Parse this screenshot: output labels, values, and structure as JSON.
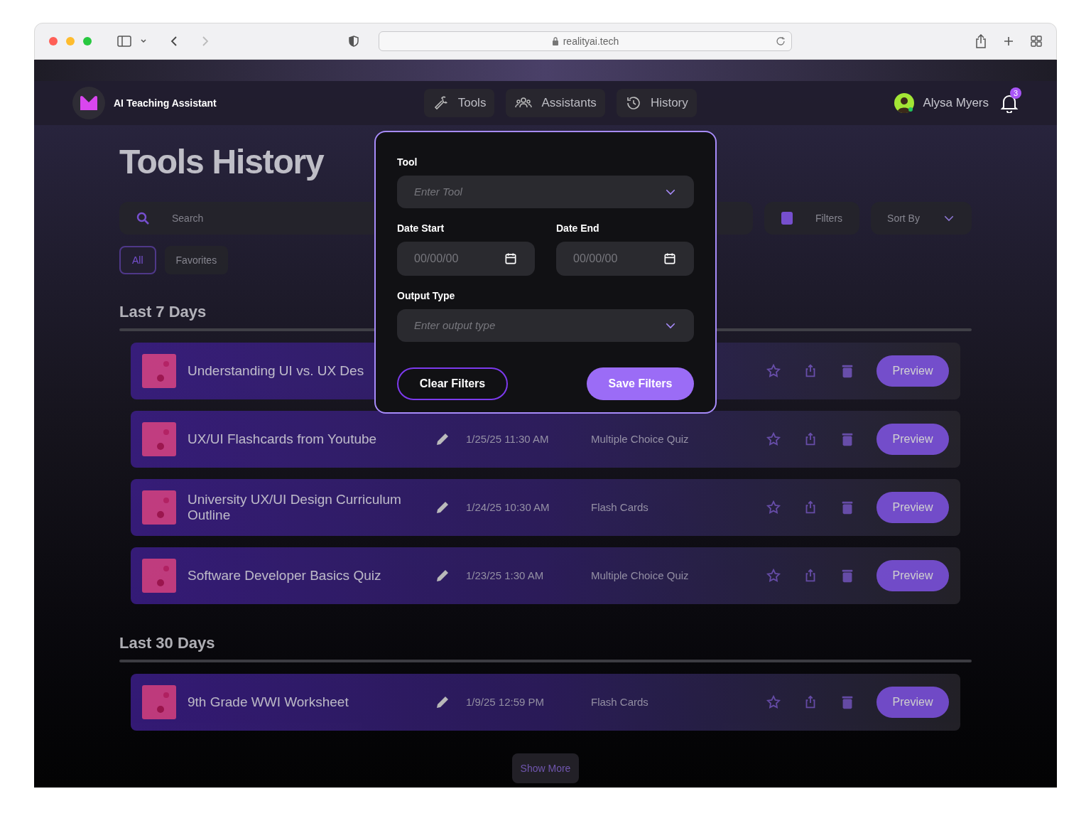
{
  "browser": {
    "url": "realityai.tech"
  },
  "header": {
    "app_name": "AI Teaching Assistant",
    "nav": [
      {
        "label": "Tools"
      },
      {
        "label": "Assistants"
      },
      {
        "label": "History"
      }
    ],
    "user_name": "Alysa Myers",
    "notification_count": "3"
  },
  "page": {
    "title": "Tools History",
    "search_placeholder": "Search",
    "filters_label": "Filters",
    "sort_label": "Sort By",
    "chips": [
      {
        "label": "All",
        "selected": true
      },
      {
        "label": "Favorites",
        "selected": false
      }
    ],
    "sections": [
      {
        "heading": "Last 7 Days",
        "rows": [
          {
            "title": "Understanding UI vs. UX Des",
            "action": "Preview"
          },
          {
            "title": "UX/UI Flashcards from Youtube",
            "date": "1/25/25 11:30 AM",
            "type": "Multiple Choice Quiz",
            "action": "Preview"
          },
          {
            "title": "University UX/UI Design Curriculum Outline",
            "date": "1/24/25 10:30 AM",
            "type": "Flash Cards",
            "action": "Preview"
          },
          {
            "title": "Software Developer Basics Quiz",
            "date": "1/23/25 1:30 AM",
            "type": "Multiple Choice Quiz",
            "action": "Preview"
          }
        ]
      },
      {
        "heading": "Last 30 Days",
        "rows": [
          {
            "title": "9th Grade WWI Worksheet",
            "date": "1/9/25 12:59 PM",
            "type": "Flash Cards",
            "action": "Preview"
          }
        ]
      }
    ],
    "show_more": "Show More"
  },
  "filter_modal": {
    "tool": {
      "label": "Tool",
      "placeholder": "Enter Tool"
    },
    "date_start": {
      "label": "Date Start",
      "placeholder": "00/00/00"
    },
    "date_end": {
      "label": "Date End",
      "placeholder": "00/00/00"
    },
    "output_type": {
      "label": "Output Type",
      "placeholder": "Enter output type"
    },
    "clear_button": "Clear Filters",
    "save_button": "Save Filters"
  }
}
